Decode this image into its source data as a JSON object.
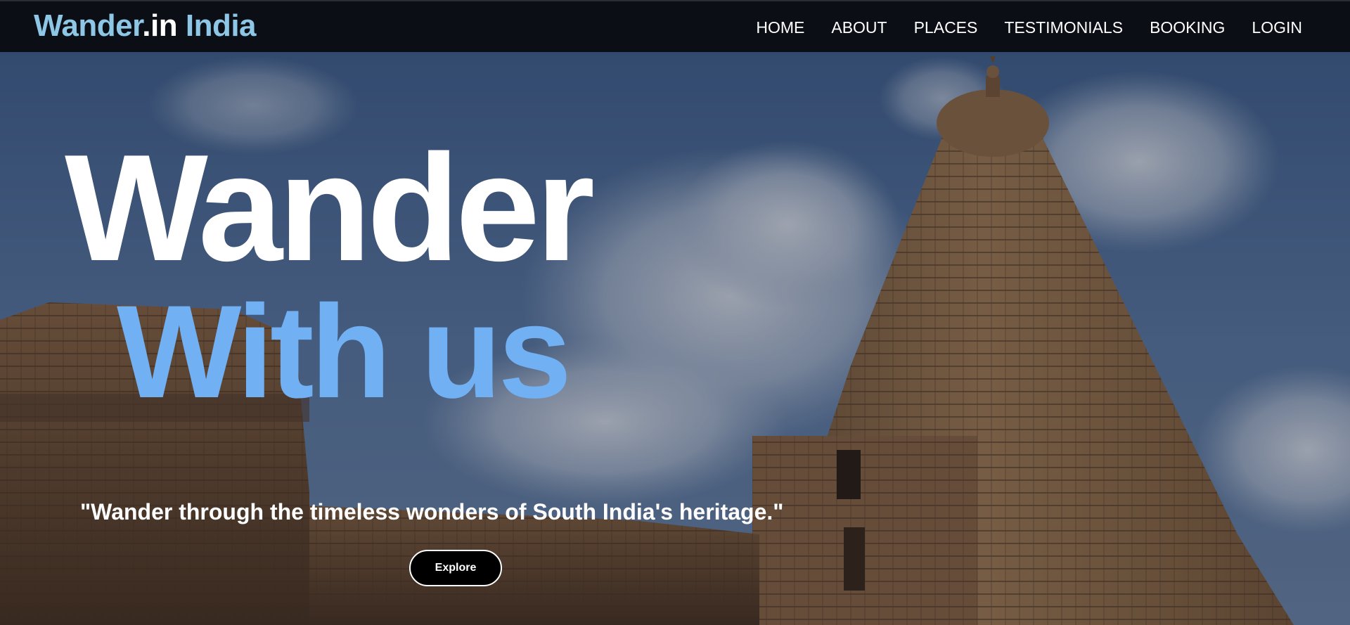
{
  "navbar": {
    "brand": {
      "part1": "Wander",
      "part2": ".in",
      "part3": " India"
    },
    "links": [
      {
        "label": "HOME"
      },
      {
        "label": "ABOUT"
      },
      {
        "label": "PLACES"
      },
      {
        "label": "TESTIMONIALS"
      },
      {
        "label": "BOOKING"
      },
      {
        "label": "LOGIN"
      }
    ]
  },
  "hero": {
    "headline_line1": "Wander",
    "headline_line2": "With us",
    "tagline": "\"Wander through the timeless wonders of South India's heritage.\"",
    "cta_label": "Explore",
    "image": "temple-tower-photo"
  },
  "colors": {
    "navbar_bg": "#0b0e15",
    "brand_accent": "#8ec6e6",
    "headline_accent": "#72b0f4",
    "sky": "#4a6d9a",
    "stone": "#8a6a48",
    "button_bg": "#000000"
  }
}
